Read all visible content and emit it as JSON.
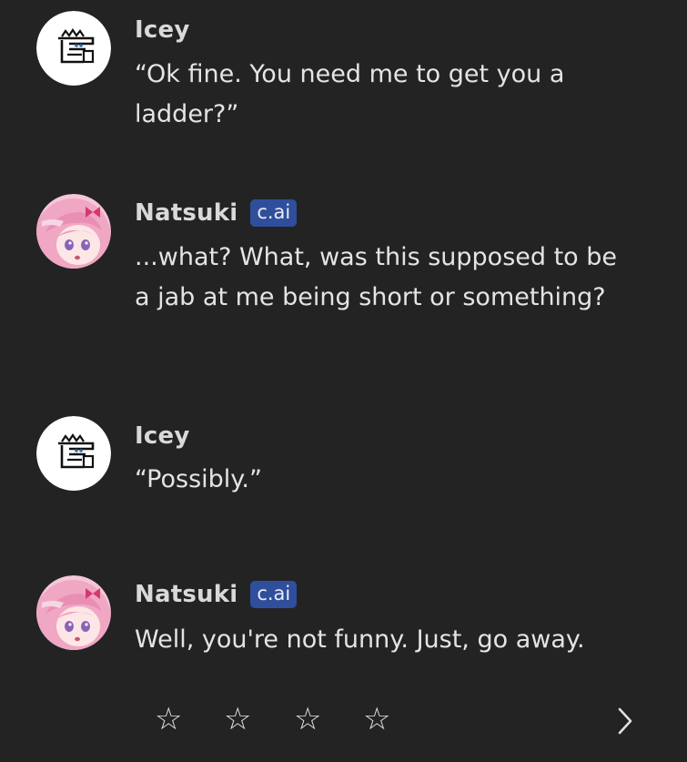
{
  "messages": [
    {
      "author": "Icey",
      "badge": "",
      "text": "“Ok fine. You need me to get you a ladder?”"
    },
    {
      "author": "Natsuki",
      "badge": "c.ai",
      "text": "...what? What, was this supposed to be a jab at me being short or something?"
    },
    {
      "author": "Icey",
      "badge": "",
      "text": "“Possibly.”"
    },
    {
      "author": "Natsuki",
      "badge": "c.ai",
      "text": "Well, you're not funny. Just, go away."
    }
  ],
  "rating": {
    "stars": [
      "☆",
      "☆",
      "☆",
      "☆"
    ],
    "selected": 0
  },
  "icons": {
    "user_avatar": "doodle-avatar-icon",
    "bot_avatar": "anime-girl-avatar-icon",
    "next": "chevron-right-icon",
    "star": "star-outline-icon"
  },
  "colors": {
    "background": "#232324",
    "badge": "#2f4f9c",
    "text": "#e4e4e4"
  }
}
